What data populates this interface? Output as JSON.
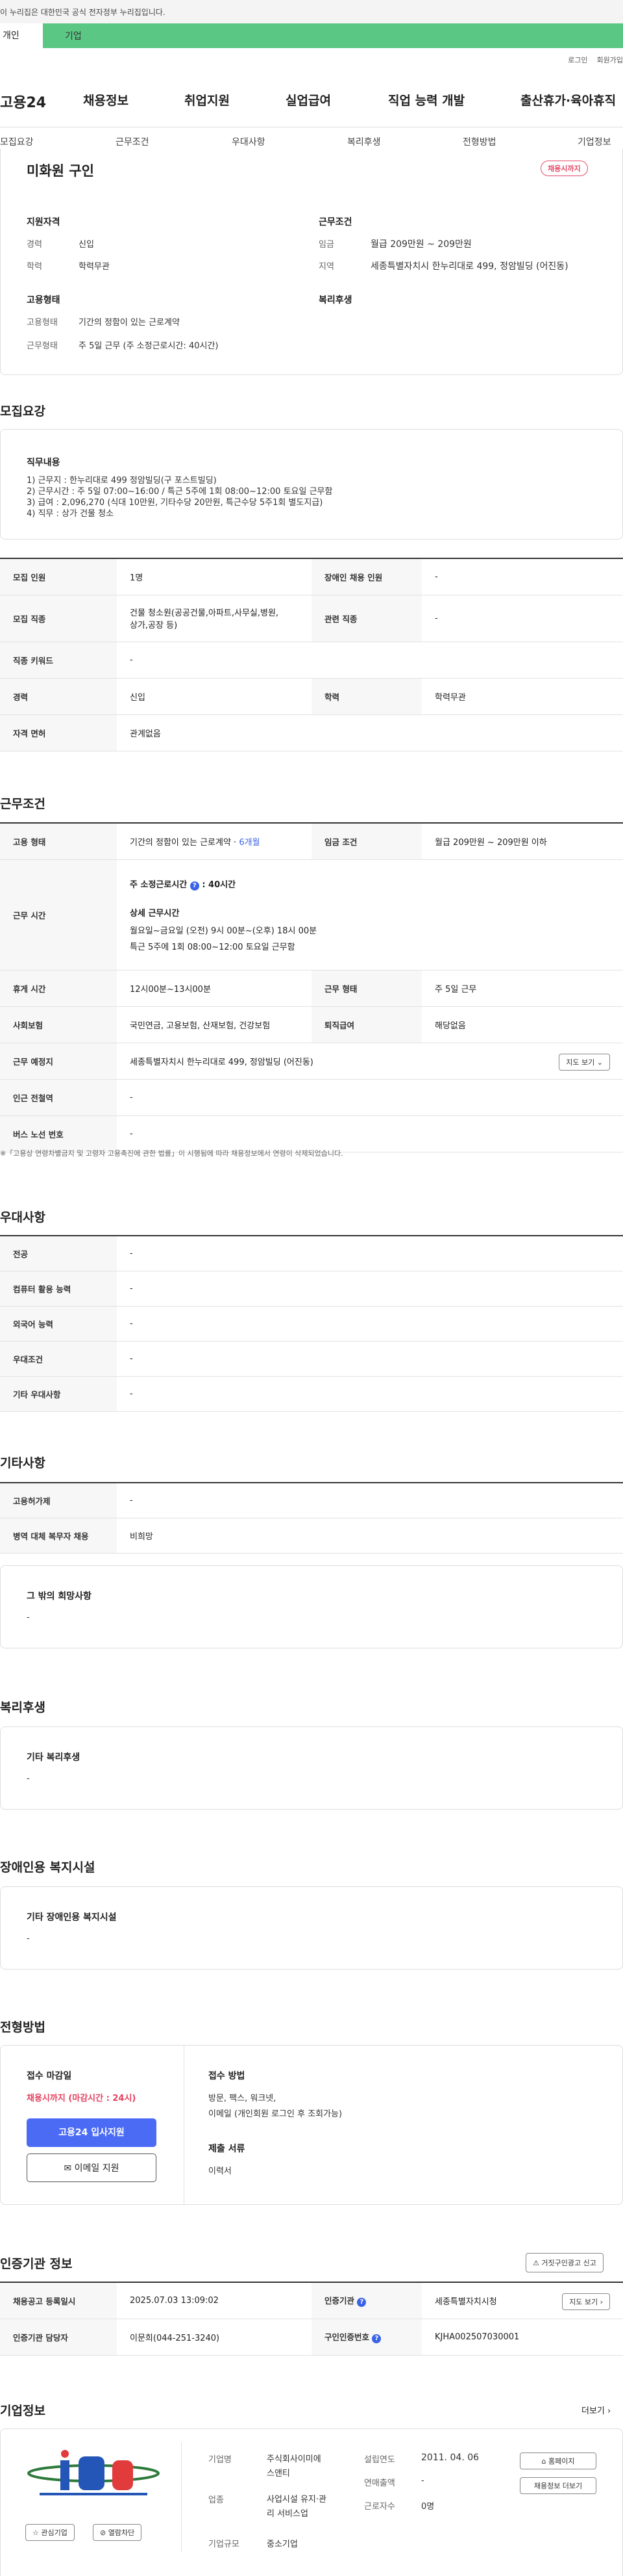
{
  "gov_banner": "이 누리집은 대한민국 공식 전자정부 누리집입니다.",
  "user_tabs": {
    "personal": "개인",
    "company": "기업"
  },
  "toplinks": [
    "로그인",
    "회원가입"
  ],
  "logo": "고용24",
  "gnb": [
    "채용정보",
    "취업지원",
    "실업급여",
    "직업 능력 개발",
    "출산휴가·육아휴직"
  ],
  "subnav": [
    "모집요강",
    "근무조건",
    "우대사항",
    "복리후생",
    "전형방법",
    "기업정보"
  ],
  "summary": {
    "title": "미화원 구인",
    "badge": "채용시까지",
    "qual_title": "지원자격",
    "career_l": "경력",
    "career_v": "신입",
    "edu_l": "학력",
    "edu_v": "학력무관",
    "cond_title": "근무조건",
    "pay_l": "임금",
    "pay_v": "월급 209만원 ~ 209만원",
    "region_l": "지역",
    "region_v": "세종특별자치시 한누리대로 499, 정암빌딩 (어진동)",
    "emp_title": "고용형태",
    "emp_type_l": "고용형태",
    "emp_type_v": "기간의 정함이 있는 근로계약",
    "work_type_l": "근무형태",
    "work_type_v": "주 5일 근무 (주 소정근로시간: 40시간)",
    "welfare_title": "복리후생"
  },
  "recruit": {
    "heading": "모집요강",
    "job_title": "직무내용",
    "job_lines": [
      "1) 근무지 : 한누리대로 499 정암빌딩(구 포스트빌딩)",
      "2) 근무시간 : 주 5일 07:00~16:00 / 특근 5주에 1회 08:00~12:00 토요일 근무함",
      "3) 급여 : 2,096,270 (식대 10만원, 기타수당 20만원, 특근수당 5주1회 별도지급)",
      "4) 직무 : 상가 건물 청소"
    ],
    "count_l": "모집 인원",
    "count_v": "1명",
    "disabled_l": "장애인 채용 인원",
    "disabled_v": "-",
    "job_l": "모집 직종",
    "job_v1": "건물 청소원(공공건물,아파트,사무실,병원,",
    "job_v2": "상가,공장 등)",
    "rel_l": "관련 직종",
    "rel_v": "-",
    "kw_l": "직종 키워드",
    "kw_v": "-",
    "career_l": "경력",
    "career_v": "신입",
    "edu_l": "학력",
    "edu_v": "학력무관",
    "license_l": "자격 면허",
    "license_v": "관계없음"
  },
  "work": {
    "heading": "근무조건",
    "emp_l": "고용 형태",
    "emp_v": "기간의 정함이 있는 근로계약 · ",
    "emp_dur": "6개월",
    "pay_l": "임금 조건",
    "pay_v": "월급 209만원 ~ 209만원 이하",
    "hours_l": "근무 시간",
    "hours_main": "주 소정근로시간",
    "hours_val": ": 40시간",
    "hours_detail": "상세 근무시간",
    "hours_d1": "월요일~금요일 (오전) 9시 00분~(오후) 18시 00분",
    "hours_d2": "특근 5주에 1회 08:00~12:00 토요일 근무함",
    "break_l": "휴게 시간",
    "break_v": "12시00분~13시00분",
    "form_l": "근무 형태",
    "form_v": "주 5일 근무",
    "ins_l": "사회보험",
    "ins_v": "국민연금, 고용보험, 산재보험, 건강보험",
    "retire_l": "퇴직급여",
    "retire_v": "해당없음",
    "place_l": "근무 예정지",
    "place_v": "세종특별자치시 한누리대로 499, 정암빌딩 (어진동)",
    "map_btn": "지도 보기",
    "subway_l": "인근 전철역",
    "subway_v": "-",
    "bus_l": "버스 노선 번호",
    "bus_v": "-",
    "note": "※「고용상 연령차별금지 및 고령자 고용촉진에 관한 법률」이 시행됨에 따라 채용정보에서 연령이 삭제되었습니다."
  },
  "pref": {
    "heading": "우대사항",
    "major_l": "전공",
    "major_v": "-",
    "pc_l": "컴퓨터 활용 능력",
    "pc_v": "-",
    "lang_l": "외국어 능력",
    "lang_v": "-",
    "cond_l": "우대조건",
    "cond_v": "-",
    "etc_l": "기타 우대사항",
    "etc_v": "-"
  },
  "etc": {
    "heading": "기타사항",
    "hire_l": "고용허가제",
    "hire_v": "-",
    "mil_l": "병역 대체 복무자 채용",
    "mil_v": "비희망",
    "wish_title": "그 밖의 희망사항",
    "wish_v": "-"
  },
  "welfare": {
    "heading": "복리후생",
    "title": "기타 복리후생",
    "v": "-"
  },
  "disab": {
    "heading": "장애인용 복지시설",
    "title": "기타 장애인용 복지시설",
    "v": "-"
  },
  "selection": {
    "heading": "전형방법",
    "deadline_title": "접수 마감일",
    "deadline_v": "채용시까지 (마감시간 : 24시)",
    "apply_btn": "고용24 입사지원",
    "email_btn": "이메일 지원",
    "method_title": "접수 방법",
    "method_v1": "방문, 팩스, 워크넷,",
    "method_v2": "이메일 (개인회원 로그인 후 조회가능)",
    "docs_title": "제출 서류",
    "docs_v": "이력서"
  },
  "agency": {
    "heading": "인증기관 정보",
    "report_btn": "거짓구인광고 신고",
    "reg_l": "채용공고 등록일시",
    "reg_v": "2025.07.03 13:09:02",
    "agency_l": "인증기관",
    "agency_v": "세종특별자치시청",
    "map_btn": "지도 보기",
    "mgr_l": "인증기관 담당자",
    "mgr_v": "이문희(044-251-3240)",
    "no_l": "구인인증번호",
    "no_v": "KJHA002507030001"
  },
  "company": {
    "heading": "기업정보",
    "more": "더보기",
    "fav": "관심기업",
    "block": "열람차단",
    "name_l": "기업명",
    "name_v1": "주식회사이미에",
    "name_v2": "스앤티",
    "year_l": "설립연도",
    "year_v": "2011. 04. 06",
    "home_btn": "홈페이지",
    "biz_l": "업종",
    "biz_v1": "사업시설 유지·관",
    "biz_v2": "리 서비스업",
    "sales_l": "연매출액",
    "sales_v": "-",
    "more_btn": "채용정보 더보기",
    "emp_l": "근로자수",
    "emp_v": "0명",
    "size_l": "기업규모",
    "size_v": "중소기업"
  }
}
